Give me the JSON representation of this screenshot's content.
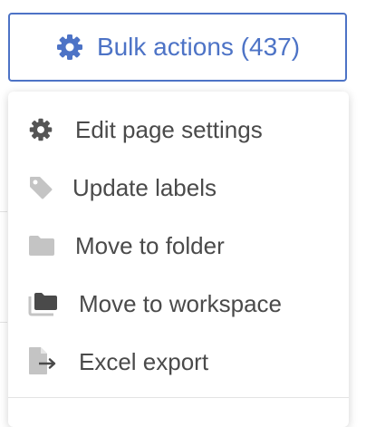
{
  "bulk_button": {
    "label": "Bulk actions (437)",
    "icon": "gear-icon",
    "color": "#4d73c6"
  },
  "menu": {
    "items": [
      {
        "label": "Edit page settings",
        "icon": "gear-icon"
      },
      {
        "label": "Update labels",
        "icon": "tag-icon"
      },
      {
        "label": "Move to folder",
        "icon": "folder-icon"
      },
      {
        "label": "Move to workspace",
        "icon": "workspace-folders-icon"
      },
      {
        "label": "Excel export",
        "icon": "file-export-icon"
      }
    ]
  },
  "colors": {
    "menu_text": "#4a4a4a",
    "icon_dark": "#555555",
    "icon_light": "#c4c4c4"
  }
}
